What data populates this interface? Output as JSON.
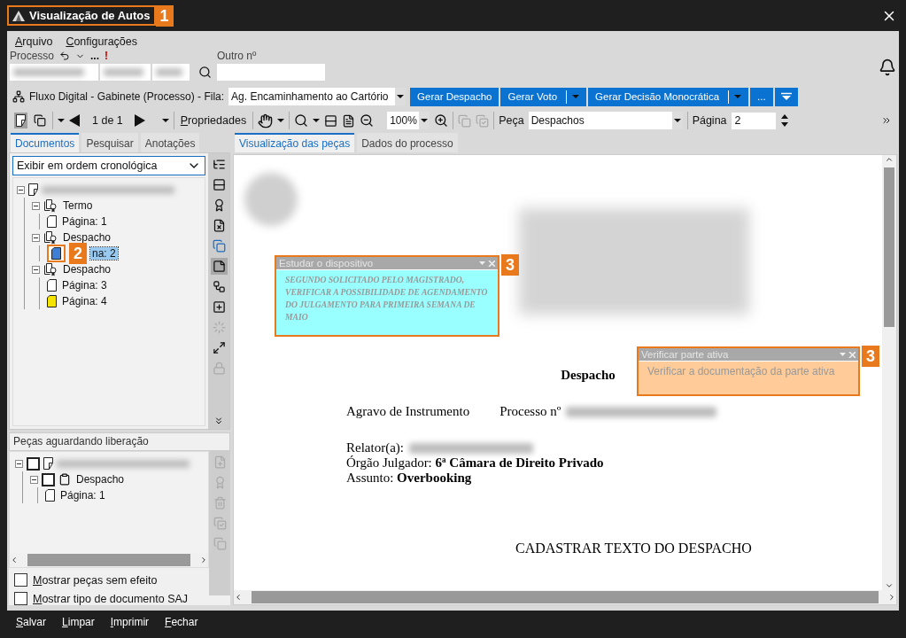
{
  "window": {
    "title": "Visualização de Autos",
    "callout": "1"
  },
  "menu": [
    "Arquivo",
    "Configurações"
  ],
  "process": {
    "label": "Processo",
    "more": "...",
    "flag": "!",
    "other_label": "Outro nº"
  },
  "flow": {
    "text": "Fluxo Digital - Gabinete (Processo) - Fila:",
    "queue": "Ag. Encaminhamento ao Cartório"
  },
  "actions": [
    {
      "label": "Gerar Despacho",
      "split": false
    },
    {
      "label": "Gerar Voto",
      "split": true
    },
    {
      "label": "Gerar Decisão Monocrática",
      "split": true
    },
    {
      "label": "...",
      "split": false
    }
  ],
  "toolbar": {
    "page_counter": "1 de 1",
    "properties": "Propriedades",
    "zoom": "100%",
    "piece_label": "Peça",
    "piece": "Despachos",
    "page_label": "Página",
    "page": "2"
  },
  "left_tabs": [
    {
      "label": "Documentos",
      "selected": true
    },
    {
      "label": "Pesquisar",
      "selected": false
    },
    {
      "label": "Anotações",
      "selected": false
    }
  ],
  "order": "Exibir em ordem cronológica",
  "tree": [
    {
      "kind": "document",
      "children": [
        {
          "kind": "group",
          "label": "Termo",
          "children": [
            {
              "kind": "page",
              "label": "Página: 1",
              "color": "#ffffff",
              "selected": false
            }
          ]
        },
        {
          "kind": "group",
          "label": "Despacho",
          "children": [
            {
              "kind": "page",
              "label": "na: 2",
              "color": "#3d7fd6",
              "selected": true,
              "callout": "2"
            }
          ]
        },
        {
          "kind": "group",
          "label": "Despacho",
          "children": [
            {
              "kind": "page",
              "label": "Página: 3",
              "color": "#ffffff",
              "selected": false
            },
            {
              "kind": "page",
              "label": "Página: 4",
              "color": "#f5e400",
              "selected": false
            }
          ]
        }
      ]
    }
  ],
  "pending": {
    "title": "Peças aguardando liberação",
    "tree": [
      {
        "kind": "document",
        "checked": false,
        "children": [
          {
            "kind": "clipboard",
            "label": "Despacho",
            "checked": false,
            "children": [
              {
                "kind": "page",
                "label": "Página: 1",
                "color": "#ffffff"
              }
            ]
          }
        ]
      }
    ]
  },
  "options": [
    {
      "label": "Mostrar peças sem efeito",
      "checked": false
    },
    {
      "label": "Mostrar tipo de documento SAJ",
      "checked": false
    }
  ],
  "right_tabs": [
    {
      "label": "Visualização das peças",
      "selected": true
    },
    {
      "label": "Dados do processo",
      "selected": false
    }
  ],
  "document": {
    "title": "Despacho",
    "case_type": "Agravo de Instrumento",
    "case_label": "Processo nº",
    "rapporteur_label": "Relator(a):",
    "court": "Órgão Julgador: **6ª Câmara de Direito Privado**",
    "subject": "Assunto: **Overbooking**",
    "body": "CADASTRAR TEXTO DO DESPACHO"
  },
  "notes": [
    {
      "title": "Estudar o dispositivo",
      "text": "SEGUNDO SOLICITADO PELO MAGISTRADO, VERIFICAR A POSSIBILIDADE DE AGENDAMENTO DO JULGAMENTO PARA PRIMEIRA SEMANA DE MAIO",
      "color": "#99ffff",
      "kind": "decorative",
      "callout": "3"
    },
    {
      "title": "Verificar parte ativa",
      "text": "Verificar a documentação da parte ativa",
      "color": "#ffcc99",
      "kind": "plain",
      "callout": "3"
    }
  ],
  "footer": [
    "Salvar",
    "Limpar",
    "Imprimir",
    "Fechar"
  ]
}
